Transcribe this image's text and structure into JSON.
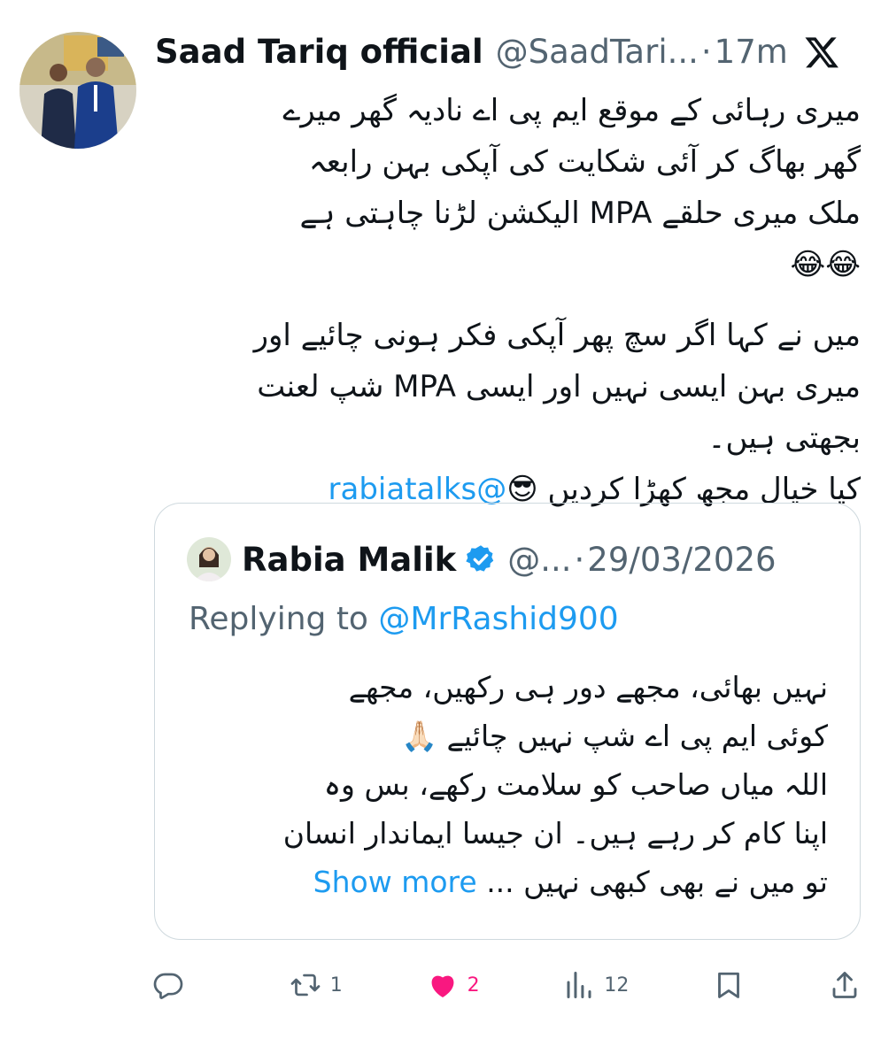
{
  "tweet": {
    "author_name": "Saad Tariq official",
    "handle": "@SaadTari...",
    "separator": "·",
    "time": "17m",
    "lines": [
      "میری رہائی کے موقع ایم پی اے نادیہ گھر میرے",
      "گھر بھاگ کر آئی شکایت کی آپکی بہن رابعہ",
      "ملک میری حلقے MPA الیکشن لڑنا چاہتی ہے",
      "😂😂"
    ],
    "lines2": [
      "میں نے کہا اگر سچ پھر آپکی فکر ہونی چائیے اور",
      "میری بہن ایسی نہیں اور ایسی MPA شپ لعنت",
      "بجھتی ہیں۔"
    ],
    "last_line_text": " کیا خیال مجھ کھڑا کردیں 😎",
    "mention": "@rabiatalks"
  },
  "quote": {
    "author_name": "Rabia Malik",
    "handle": "@...",
    "separator": "·",
    "date": "29/03/2026",
    "replying_label": "Replying to",
    "replying_mention": "@MrRashid900",
    "lines": [
      "نہیں بھائی، مجھے دور ہی رکھیں، مجھے",
      "کوئی ایم پی اے شپ نہیں چائیے 🙏🏻",
      "اللہ میاں صاحب کو سلامت رکھے، بس وہ",
      "اپنا کام کر رہے ہیں۔ ان جیسا ایماندار انسان"
    ],
    "last_line_text": "تو میں نے بھی کبھی نہیں ...",
    "show_more": "Show more"
  },
  "actions": {
    "reply_count": "",
    "retweet_count": "1",
    "like_count": "2",
    "views_count": "12"
  },
  "icons": {
    "x_logo": "x-logo-icon",
    "verified": "verified-badge-icon",
    "reply": "reply-icon",
    "retweet": "retweet-icon",
    "like": "heart-filled-icon",
    "views": "views-icon",
    "bookmark": "bookmark-icon",
    "share": "share-icon"
  },
  "colors": {
    "text": "#0f1419",
    "secondary": "#536471",
    "link": "#1d9bf0",
    "like": "#f91880",
    "border": "#cfd9de"
  }
}
